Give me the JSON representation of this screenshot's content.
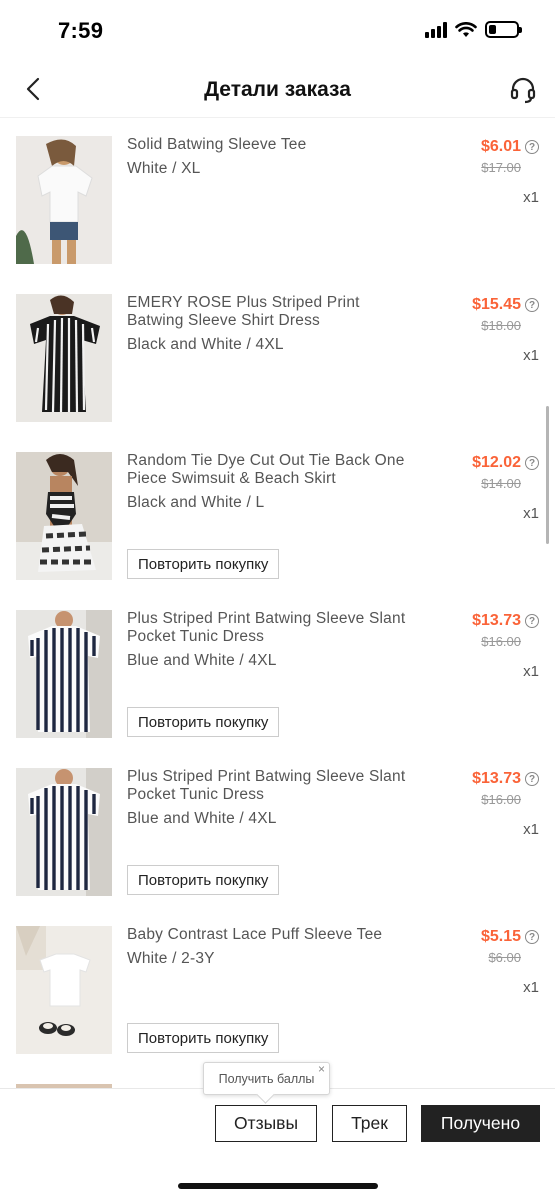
{
  "status": {
    "time": "7:59"
  },
  "header": {
    "title": "Детали заказа"
  },
  "items": [
    {
      "title": "Solid Batwing Sleeve Tee",
      "variant": "White / XL",
      "price": "$6.01",
      "old_price": "$17.00",
      "qty": "x1",
      "rebuy": ""
    },
    {
      "title": "EMERY ROSE Plus Striped Print Batwing Sleeve Shirt Dress",
      "variant": "Black and White / 4XL",
      "price": "$15.45",
      "old_price": "$18.00",
      "qty": "x1",
      "rebuy": ""
    },
    {
      "title": "Random Tie Dye Cut Out Tie Back One Piece Swimsuit & Beach Skirt",
      "variant": "Black and White / L",
      "price": "$12.02",
      "old_price": "$14.00",
      "qty": "x1",
      "rebuy": "Повторить покупку"
    },
    {
      "title": "Plus Striped Print Batwing Sleeve Slant Pocket Tunic Dress",
      "variant": "Blue and White / 4XL",
      "price": "$13.73",
      "old_price": "$16.00",
      "qty": "x1",
      "rebuy": "Повторить покупку"
    },
    {
      "title": "Plus Striped Print Batwing Sleeve Slant Pocket Tunic Dress",
      "variant": "Blue and White / 4XL",
      "price": "$13.73",
      "old_price": "$16.00",
      "qty": "x1",
      "rebuy": "Повторить покупку"
    },
    {
      "title": "Baby Contrast Lace Puff Sleeve Tee",
      "variant": "White / 2-3Y",
      "price": "$5.15",
      "old_price": "$6.00",
      "qty": "x1",
      "rebuy": "Повторить покупку"
    }
  ],
  "help_glyph": "?",
  "tooltip": {
    "text": "Получить баллы",
    "close": "×"
  },
  "actions": {
    "reviews": "Отзывы",
    "track": "Трек",
    "received": "Получено"
  },
  "colors": {
    "price": "#fa6338",
    "primary_button": "#222222"
  }
}
